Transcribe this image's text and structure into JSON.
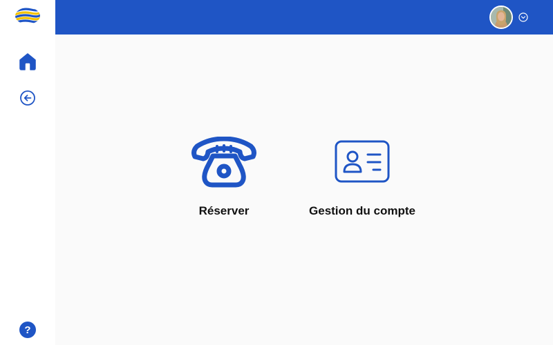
{
  "sidebar": {
    "logo_icon": "striped-globe-logo",
    "items": [
      {
        "name": "home",
        "icon": "home-icon"
      },
      {
        "name": "back",
        "icon": "arrow-left-circle-icon"
      }
    ],
    "help_icon": "question-circle-icon",
    "help_label": "?"
  },
  "header": {
    "user_menu": {
      "avatar": "avatar",
      "dropdown_icon": "chevron-down-circle-icon"
    }
  },
  "main": {
    "tiles": [
      {
        "label": "Réserver",
        "icon": "telephone-icon"
      },
      {
        "label": "Gestion du compte",
        "icon": "id-card-icon"
      }
    ]
  },
  "colors": {
    "primary": "#1f55c5",
    "logo_yellow": "#f2c200",
    "background": "#fafafa",
    "text": "#111111"
  }
}
